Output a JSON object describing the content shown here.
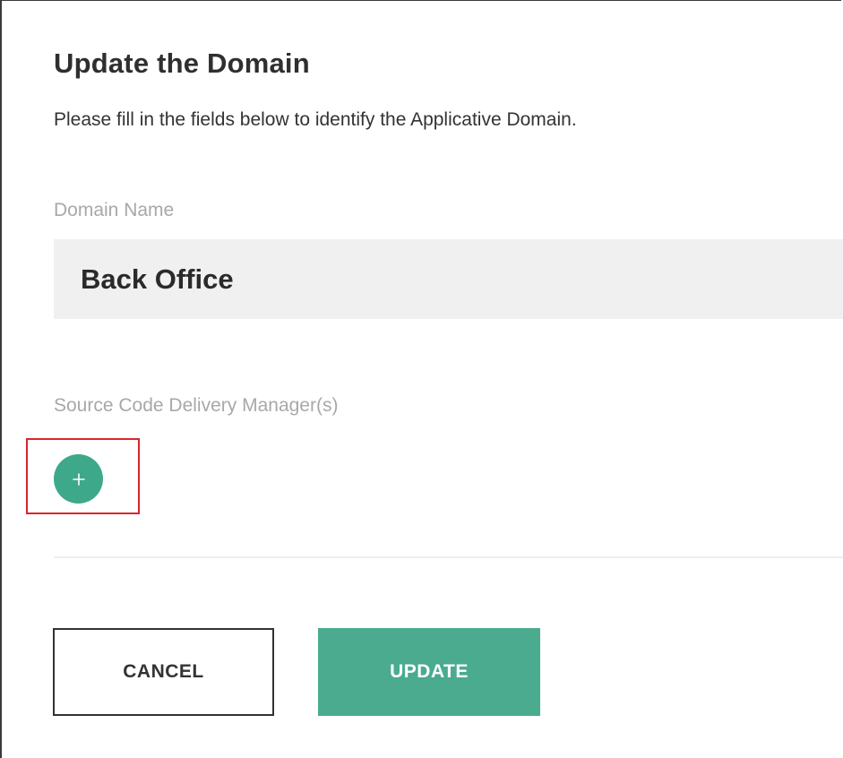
{
  "dialog": {
    "title": "Update the Domain",
    "subtitle": "Please fill in the fields below to identify the Applicative Domain."
  },
  "domain_name": {
    "label": "Domain Name",
    "value": "Back Office"
  },
  "source_code_delivery_managers": {
    "label": "Source Code Delivery Manager(s)",
    "add_icon": "plus-icon"
  },
  "actions": {
    "cancel_label": "CANCEL",
    "update_label": "UPDATE"
  },
  "colors": {
    "accent": "#4aab8f",
    "highlight": "#d9262e"
  }
}
